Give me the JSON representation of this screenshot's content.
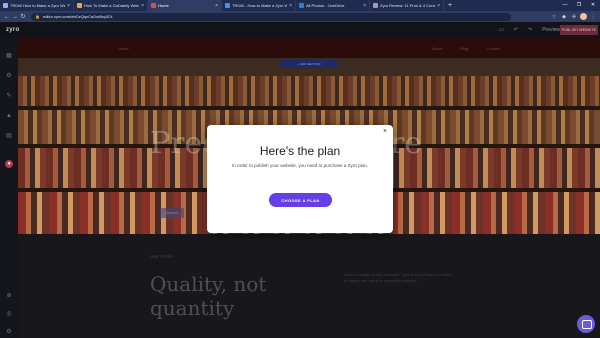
{
  "browser": {
    "tabs": [
      {
        "label": "TR040 How to Make a Zyro Web...",
        "favicon_color": "#8ab4f8"
      },
      {
        "label": "How To Make a GoDaddy Websi...",
        "favicon_color": "#f4a14a"
      },
      {
        "label": "Home",
        "favicon_color": "#e04a55"
      },
      {
        "label": "TR040 - How to Make a Zyro W...",
        "favicon_color": "#4a8af4"
      },
      {
        "label": "All Photos - OneDrive",
        "favicon_color": "#2f7fd1"
      },
      {
        "label": "Zyro Review: 11 Pros & 4 Cons (...",
        "favicon_color": "#9aa0a6"
      }
    ],
    "active_tab_index": 2,
    "new_tab": "+",
    "url": "editor.zyro.com/ebOzQqxCsOw0kq3OL",
    "window_controls": [
      "—",
      "❐",
      "✕"
    ]
  },
  "editor": {
    "logo": "zyro",
    "publish_label": "PUBLISH WEBSITE",
    "preview_label": "Preview",
    "sidebar_icons": [
      "grid-icon",
      "gear-icon",
      "brush-icon",
      "chart-icon",
      "store-icon",
      "circle-badge-icon"
    ],
    "sidebar_bottom_icons": [
      "cart-icon",
      "globe-icon",
      "settings-icon"
    ]
  },
  "site": {
    "nav_items": [
      "Home",
      "About",
      "Blog",
      "Contact"
    ],
    "add_section_label": "+ ADD SECTION",
    "hero_title": "Predict the future",
    "hero_button": "Check it",
    "section_kicker": "OUR STORY",
    "section_heading": "Quality, not quantity",
    "section_text": "Here's a single quality example. Zyro is everything you need to create and run your personal websites."
  },
  "modal": {
    "title": "Here's the plan",
    "body": "In order to publish your website, you need to purchase a Zyro plan.",
    "button_label": "CHOOSE A PLAN",
    "close_label": "×",
    "accent": "#673de6"
  }
}
